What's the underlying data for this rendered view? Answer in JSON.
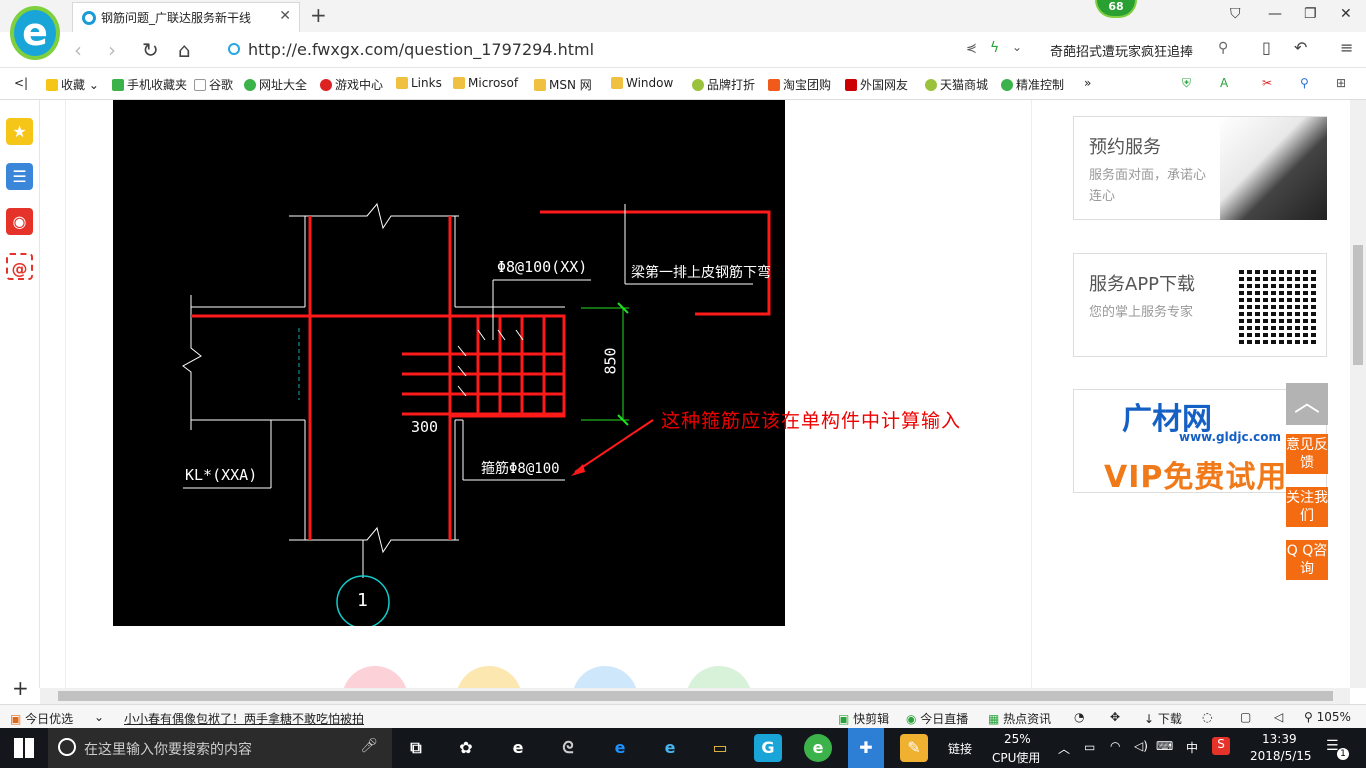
{
  "browser": {
    "tab_title": "钢筋问题_广联达服务新干线",
    "badge_count": "68",
    "url": "http://e.fwxgx.com/question_1797294.html",
    "search_hint": "奇葩招式遭玩家疯狂追捧"
  },
  "bookmarks": [
    "收藏",
    "手机收藏夹",
    "谷歌",
    "网址大全",
    "游戏中心",
    "Links",
    "Microsof",
    "MSN 网",
    "Window",
    "品牌打折",
    "淘宝团购",
    "外国网友",
    "天猫商城",
    "精准控制"
  ],
  "cad": {
    "stirrup_top": "Φ8@100(XX)",
    "beam_note": "梁第一排上皮钢筋下弯",
    "dim_vertical": "850",
    "dim_horizontal": "300",
    "stirrup_bottom": "箍筋Φ8@100",
    "beam_label": "KL*(XXA)",
    "axis_number": "1",
    "annotation": "这种箍筋应该在单构件中计算输入"
  },
  "right_panel": {
    "reserve_title": "预约服务",
    "reserve_desc": "服务面对面，承诺心连心",
    "app_title": "服务APP下载",
    "app_desc": "您的掌上服务专家",
    "gld_logo": "广材网",
    "gld_url": "www.gldjc.com",
    "vip_text": "VIP免费试用",
    "feedback": "意见反馈",
    "follow": "关注我们",
    "qq": "Q Q咨询"
  },
  "statusbar": {
    "today_pick": "今日优选",
    "news": "小小春有偶像包袱了！两手拿糖不敢吃怕被拍",
    "quick_cut": "快剪辑",
    "live": "今日直播",
    "hot": "热点资讯",
    "download": "下载",
    "zoom": "105%"
  },
  "taskbar": {
    "search_placeholder": "在这里输入你要搜索的内容",
    "link_label": "链接",
    "cpu_percent": "25%",
    "cpu_label": "CPU使用",
    "ime": "中",
    "time": "13:39",
    "date": "2018/5/15",
    "notif_count": "1"
  },
  "colors": {
    "cad_red": "#ff1a1a",
    "cad_green": "#22dd22",
    "orange": "#f36c12",
    "annot_red": "#e00000"
  }
}
